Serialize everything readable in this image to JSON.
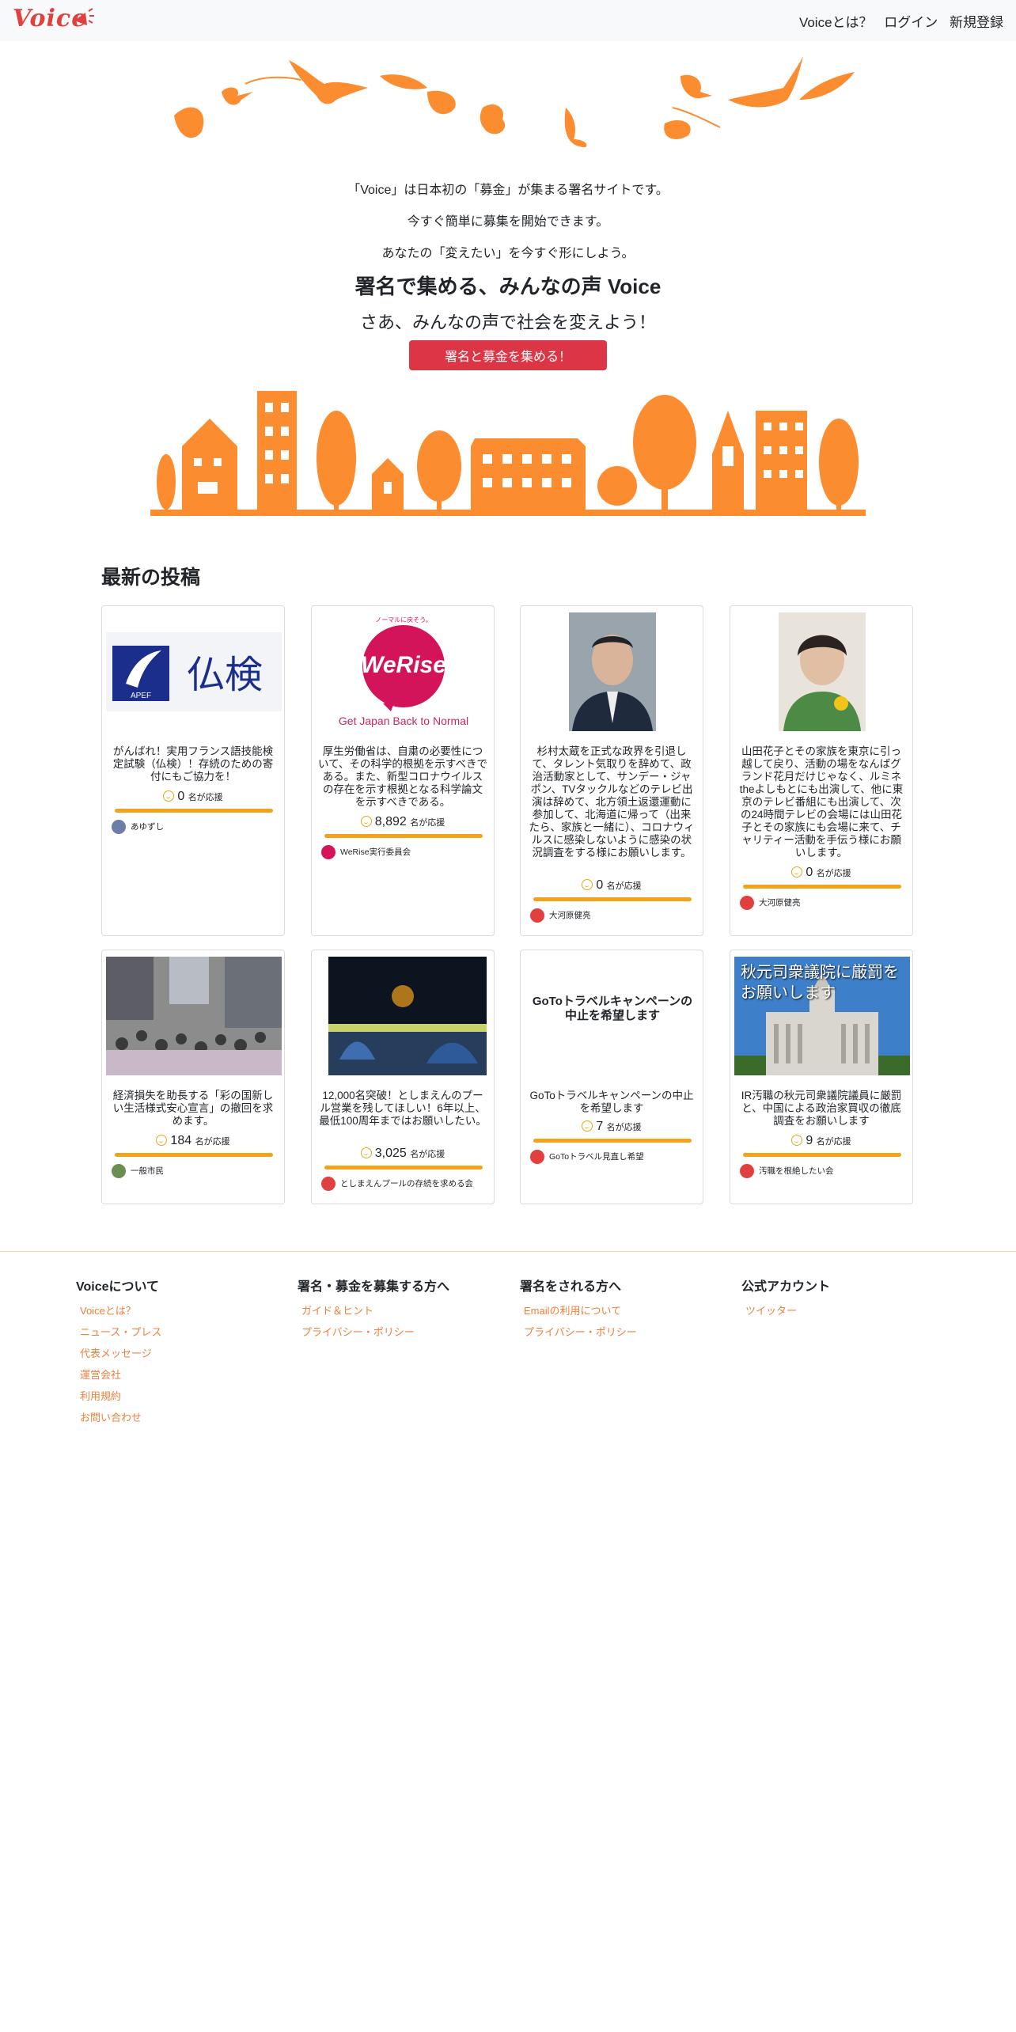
{
  "nav": {
    "brand": "Voice",
    "links": [
      "Voiceとは？",
      "ログイン",
      "新規登録"
    ]
  },
  "hero": {
    "line1": "「Voice」は日本初の「募金」が集まる署名サイトです。",
    "line2": "今すぐ簡単に募集を開始できます。",
    "line3": "あなたの「変えたい」を今すぐ形にしよう。",
    "headline": "署名で集める、みんなの声 Voice",
    "subheadline": "さあ、みんなの声で社会を変えよう！",
    "cta": "署名と募金を集める！"
  },
  "latest": {
    "title": "最新の投稿",
    "support_suffix": "名が応援",
    "cards": [
      {
        "image_text": "仏検",
        "image_sub": "APEF",
        "title": "がんばれ！実用フランス語技能検定試験（仏検）！存続のための寄付にもご協力を！",
        "count": "0",
        "user": "あゆずし"
      },
      {
        "image_text": "WeRise",
        "image_sub": "Get Japan Back to Normal",
        "image_top": "ノーマルに戻そう。",
        "title": "厚生労働省は、自粛の必要性について、その科学的根拠を示すべきである。また、新型コロナウイルスの存在を示す根拠となる科学論文を示すべきである。",
        "count": "8,892",
        "user": "WeRise実行委員会"
      },
      {
        "image_text": "",
        "title": "杉村太蔵を正式な政界を引退して、タレント気取りを辞めて、政治活動家として、サンデー・ジャポン、TVタックルなどのテレビ出演は辞めて、北方領土返還運動に参加して、北海道に帰って（出来たら、家族と一緒に）、コロナウィルスに感染しないように感染の状況調査をする様にお願いします。",
        "count": "0",
        "user": "大河原健亮"
      },
      {
        "image_text": "",
        "title": "山田花子とその家族を東京に引っ越して戻り、活動の場をなんばグランド花月だけじゃなく、ルミネtheよしもとにも出演して、他に東京のテレビ番組にも出演して、次の24時間テレビの会場には山田花子とその家族にも会場に来て、チャリティー活動を手伝う様にお願いします。",
        "count": "0",
        "user": "大河原健亮"
      },
      {
        "image_text": "",
        "title": "経済損失を助長する「彩の国新しい生活様式安心宣言」の撤回を求めます。",
        "count": "184",
        "user": "一般市民"
      },
      {
        "image_text": "",
        "title": "12,000名突破！としまえんのプール営業を残してほしい！6年以上、最低100周年まではお願いしたい。",
        "count": "3,025",
        "user": "としまえんプールの存続を求める会"
      },
      {
        "image_text": "GoToトラベルキャンペーンの中止を希望します",
        "title": "GoToトラベルキャンペーンの中止を希望します",
        "count": "7",
        "user": "GoToトラベル見直し希望"
      },
      {
        "image_text": "秋元司衆議院に厳罰をお願いします",
        "title": "IR汚職の秋元司衆議院議員に厳罰と、中国による政治家買収の徹底調査をお願いします",
        "count": "9",
        "user": "汚職を根絶したい会"
      }
    ]
  },
  "footer": {
    "columns": [
      {
        "title": "Voiceについて",
        "links": [
          "Voiceとは？",
          "ニュース・プレス",
          "代表メッセージ",
          "運営会社",
          "利用規約",
          "お問い合わせ"
        ]
      },
      {
        "title": "署名・募金を募集する方へ",
        "links": [
          "ガイド＆ヒント",
          "プライバシー・ポリシー"
        ]
      },
      {
        "title": "署名をされる方へ",
        "links": [
          "Emailの利用について",
          "プライバシー・ポリシー"
        ]
      },
      {
        "title": "公式アカウント",
        "links": [
          "ツイッター"
        ]
      }
    ]
  },
  "colors": {
    "accent": "#dc3545",
    "orange": "#fb8c2f",
    "link": "#f07f3c",
    "bar": "#f2a31c"
  }
}
